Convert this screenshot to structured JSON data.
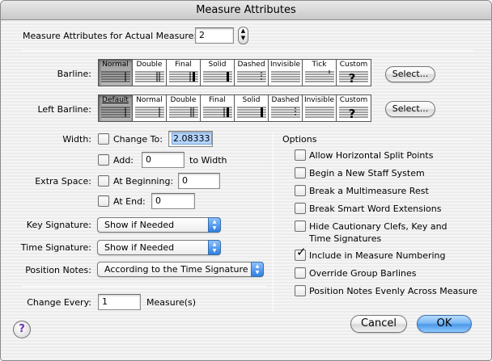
{
  "window": {
    "title": "Measure Attributes"
  },
  "measure": {
    "label": "Measure Attributes for Actual Measure:",
    "value": "2"
  },
  "barline": {
    "label": "Barline:",
    "options": [
      "Normal",
      "Double",
      "Final",
      "Solid",
      "Dashed",
      "Invisible",
      "Tick",
      "Custom"
    ],
    "selected": "Normal",
    "select_label": "Select..."
  },
  "left_barline": {
    "label": "Left Barline:",
    "options": [
      "Default",
      "Normal",
      "Double",
      "Final",
      "Solid",
      "Dashed",
      "Invisible",
      "Custom"
    ],
    "selected": "Default",
    "select_label": "Select..."
  },
  "width": {
    "label": "Width:",
    "change_to_label": "Change To:",
    "change_to_value": "2.08333",
    "change_to_checked": false,
    "add_label": "Add:",
    "add_value": "0",
    "add_suffix": "to Width",
    "add_checked": false
  },
  "extra_space": {
    "label": "Extra Space:",
    "at_beginning_label": "At Beginning:",
    "at_beginning_value": "0",
    "at_end_label": "At End:",
    "at_end_value": "0"
  },
  "key_signature": {
    "label": "Key Signature:",
    "value": "Show if Needed"
  },
  "time_signature": {
    "label": "Time Signature:",
    "value": "Show if Needed"
  },
  "position_notes": {
    "label": "Position Notes:",
    "value": "According to the Time Signature"
  },
  "change_every": {
    "label": "Change Every:",
    "value": "1",
    "suffix": "Measure(s)"
  },
  "options": {
    "title": "Options",
    "items": [
      {
        "label": "Allow Horizontal Split Points",
        "checked": false
      },
      {
        "label": "Begin a New Staff System",
        "checked": false
      },
      {
        "label": "Break a Multimeasure Rest",
        "checked": false
      },
      {
        "label": "Break Smart Word Extensions",
        "checked": false
      },
      {
        "label": "Hide Cautionary Clefs, Key and",
        "label2": "Time Signatures",
        "checked": false
      },
      {
        "label": "Include in Measure Numbering",
        "checked": true
      },
      {
        "label": "Override Group Barlines",
        "checked": false
      },
      {
        "label": "Position Notes Evenly Across Measure",
        "checked": false
      }
    ]
  },
  "buttons": {
    "cancel": "Cancel",
    "ok": "OK",
    "help": "?"
  },
  "colors": {
    "accent": "#4c98e8",
    "selection": "#b5d5ff"
  }
}
